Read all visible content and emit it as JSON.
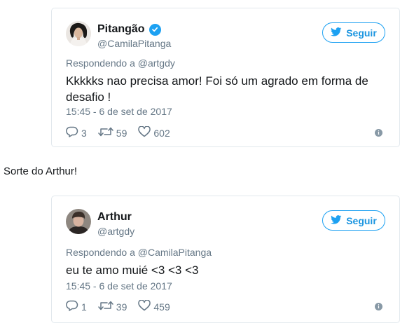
{
  "tweets": [
    {
      "name": "Pitangão",
      "verified": true,
      "handle": "@CamilaPitanga",
      "follow_label": "Seguir",
      "replying": "Respondendo a @artgdy",
      "text": "Kkkkks nao precisa amor! Foi só um agrado em forma de desafio !",
      "timestamp": "15:45 - 6 de set de 2017",
      "replies": "3",
      "retweets": "59",
      "likes": "602"
    },
    {
      "name": "Arthur",
      "verified": false,
      "handle": "@artgdy",
      "follow_label": "Seguir",
      "replying": "Respondendo a @CamilaPitanga",
      "text": "eu te amo muié <3 <3 <3",
      "timestamp": "15:45 - 6 de set de 2017",
      "replies": "1",
      "retweets": "39",
      "likes": "459"
    }
  ],
  "between_text": "Sorte do Arthur!",
  "colors": {
    "accent": "#1da1f2",
    "follow_text": "#1b95e0",
    "secondary_text": "#657786",
    "border": "#e1e8ed"
  },
  "icons": [
    "verified-badge-icon",
    "twitter-bird-icon",
    "reply-icon",
    "retweet-icon",
    "heart-icon",
    "info-icon"
  ]
}
